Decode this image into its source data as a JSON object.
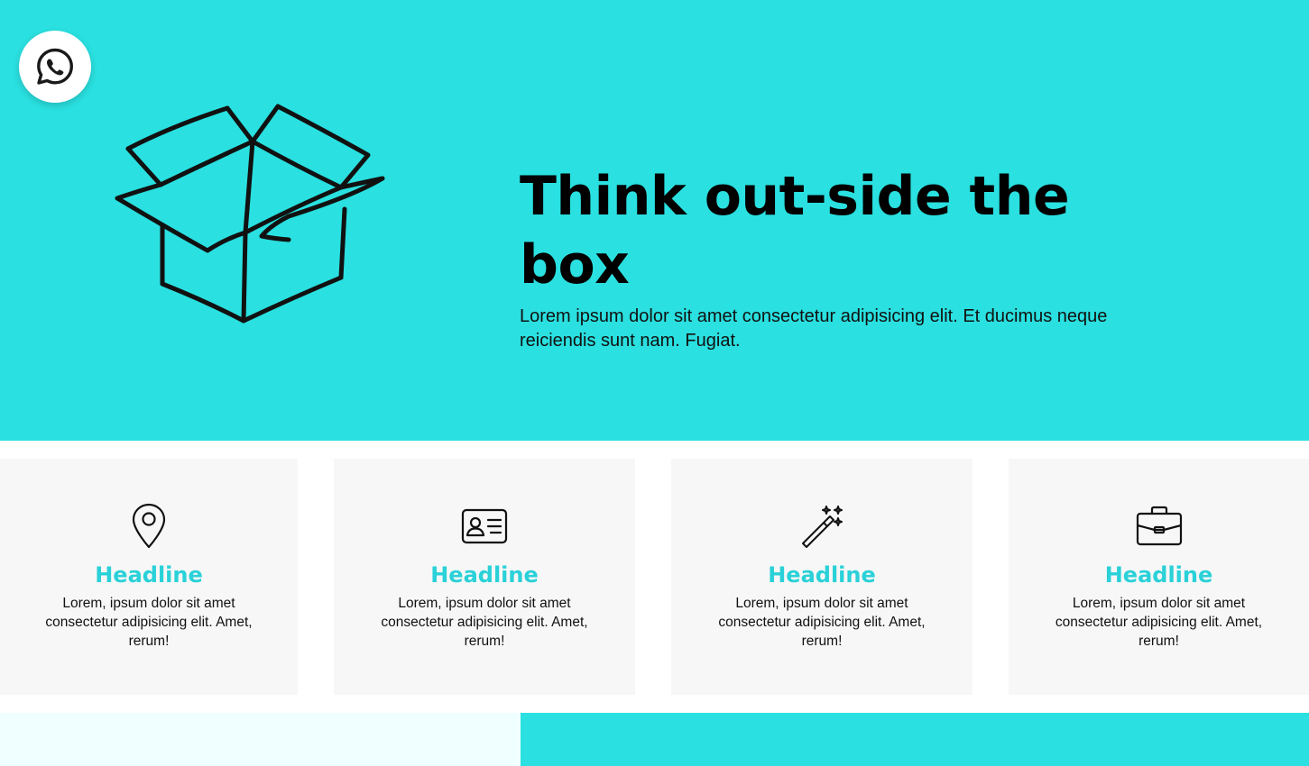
{
  "colors": {
    "hero_background": "#2ae0e0",
    "card_background": "#f7f7f7",
    "headline_accent": "#2ad1d8",
    "bottom_left_background": "#f0ffff",
    "bottom_right_background": "#2ae0e0"
  },
  "floating_button": {
    "icon": "whatsapp-icon"
  },
  "hero": {
    "illustration": "open-box-illustration",
    "title": "Think out-side the box",
    "subtitle": "Lorem ipsum dolor sit amet consectetur adipisicing elit. Et ducimus neque reiciendis sunt nam. Fugiat."
  },
  "features": [
    {
      "icon": "location-pin-icon",
      "headline": "Headline",
      "text": "Lorem, ipsum dolor sit amet consectetur adipisicing elit. Amet, rerum!"
    },
    {
      "icon": "id-card-icon",
      "headline": "Headline",
      "text": "Lorem, ipsum dolor sit amet consectetur adipisicing elit. Amet, rerum!"
    },
    {
      "icon": "magic-wand-icon",
      "headline": "Headline",
      "text": "Lorem, ipsum dolor sit amet consectetur adipisicing elit. Amet, rerum!"
    },
    {
      "icon": "briefcase-icon",
      "headline": "Headline",
      "text": "Lorem, ipsum dolor sit amet consectetur adipisicing elit. Amet, rerum!"
    }
  ]
}
